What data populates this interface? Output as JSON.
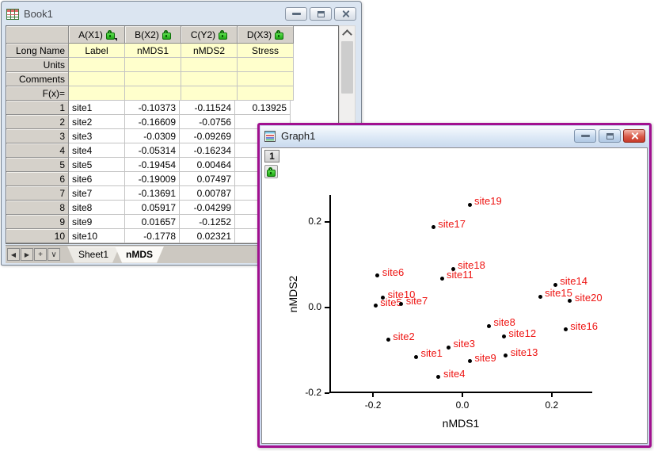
{
  "workbook": {
    "window_title": "Book1",
    "column_headers": [
      {
        "label": "A(X1)",
        "lock": true,
        "dropdown": true
      },
      {
        "label": "B(X2)",
        "lock": true,
        "dropdown": false
      },
      {
        "label": "C(Y2)",
        "lock": true,
        "dropdown": false
      },
      {
        "label": "D(X3)",
        "lock": true,
        "dropdown": false
      }
    ],
    "label_rows": [
      {
        "label": "Long Name",
        "values": [
          "Label",
          "nMDS1",
          "nMDS2",
          "Stress"
        ]
      },
      {
        "label": "Units",
        "values": [
          "",
          "",
          "",
          ""
        ]
      },
      {
        "label": "Comments",
        "values": [
          "",
          "",
          "",
          ""
        ]
      },
      {
        "label": "F(x)=",
        "values": [
          "",
          "",
          "",
          ""
        ]
      }
    ],
    "data_rows": [
      {
        "index": "1",
        "values": [
          "site1",
          "-0.10373",
          "-0.11524",
          "0.13925"
        ]
      },
      {
        "index": "2",
        "values": [
          "site2",
          "-0.16609",
          "-0.0756",
          ""
        ]
      },
      {
        "index": "3",
        "values": [
          "site3",
          "-0.0309",
          "-0.09269",
          ""
        ]
      },
      {
        "index": "4",
        "values": [
          "site4",
          "-0.05314",
          "-0.16234",
          ""
        ]
      },
      {
        "index": "5",
        "values": [
          "site5",
          "-0.19454",
          "0.00464",
          ""
        ]
      },
      {
        "index": "6",
        "values": [
          "site6",
          "-0.19009",
          "0.07497",
          ""
        ]
      },
      {
        "index": "7",
        "values": [
          "site7",
          "-0.13691",
          "0.00787",
          ""
        ]
      },
      {
        "index": "8",
        "values": [
          "site8",
          "0.05917",
          "-0.04299",
          ""
        ]
      },
      {
        "index": "9",
        "values": [
          "site9",
          "0.01657",
          "-0.1252",
          ""
        ]
      },
      {
        "index": "10",
        "values": [
          "site10",
          "-0.1778",
          "0.02321",
          ""
        ]
      }
    ],
    "nav_buttons": [
      "◀",
      "▶",
      "+",
      "∨"
    ],
    "tabs": [
      {
        "label": "Sheet1",
        "active": false
      },
      {
        "label": "nMDS",
        "active": true
      }
    ]
  },
  "graph": {
    "window_title": "Graph1",
    "layer_badge": "1"
  },
  "chart_data": {
    "type": "scatter",
    "title": "",
    "xlabel": "nMDS1",
    "ylabel": "nMDS2",
    "xlim": [
      -0.296,
      0.289
    ],
    "ylim": [
      -0.198,
      0.263
    ],
    "grid": false,
    "xticks": [
      {
        "v": -0.2,
        "label": "-0.2"
      },
      {
        "v": 0.0,
        "label": "0.0"
      },
      {
        "v": 0.2,
        "label": "0.2"
      }
    ],
    "yticks": [
      {
        "v": 0.2,
        "label": "0.2"
      },
      {
        "v": 0.0,
        "label": "0.0"
      },
      {
        "v": -0.2,
        "label": "-0.2"
      }
    ],
    "marker_color": "#000000",
    "label_color": "#ee1412",
    "points": [
      {
        "label": "site1",
        "x": -0.10373,
        "y": -0.11524
      },
      {
        "label": "site2",
        "x": -0.16609,
        "y": -0.0756
      },
      {
        "label": "site3",
        "x": -0.0309,
        "y": -0.09269
      },
      {
        "label": "site4",
        "x": -0.05314,
        "y": -0.16234
      },
      {
        "label": "site5",
        "x": -0.19454,
        "y": 0.00464
      },
      {
        "label": "site6",
        "x": -0.19009,
        "y": 0.07497
      },
      {
        "label": "site7",
        "x": -0.13691,
        "y": 0.00787
      },
      {
        "label": "site8",
        "x": 0.05917,
        "y": -0.04299
      },
      {
        "label": "site9",
        "x": 0.01657,
        "y": -0.1252
      },
      {
        "label": "site10",
        "x": -0.1778,
        "y": 0.02321
      },
      {
        "label": "site11",
        "x": -0.046,
        "y": 0.068
      },
      {
        "label": "site12",
        "x": 0.093,
        "y": -0.068
      },
      {
        "label": "site13",
        "x": 0.097,
        "y": -0.112
      },
      {
        "label": "site14",
        "x": 0.208,
        "y": 0.053
      },
      {
        "label": "site15",
        "x": 0.174,
        "y": 0.026
      },
      {
        "label": "site16",
        "x": 0.231,
        "y": -0.051
      },
      {
        "label": "site17",
        "x": -0.065,
        "y": 0.188
      },
      {
        "label": "site18",
        "x": -0.021,
        "y": 0.09
      },
      {
        "label": "site19",
        "x": 0.016,
        "y": 0.24
      },
      {
        "label": "site20",
        "x": 0.241,
        "y": 0.015
      }
    ]
  },
  "colors": {
    "active_window_border": "#a1108f",
    "lock_green": "#1fa816",
    "point_label_red": "#ee1412",
    "header_label_yellow": "#ffffcc",
    "column_header_gray": "#d5d1ca"
  }
}
